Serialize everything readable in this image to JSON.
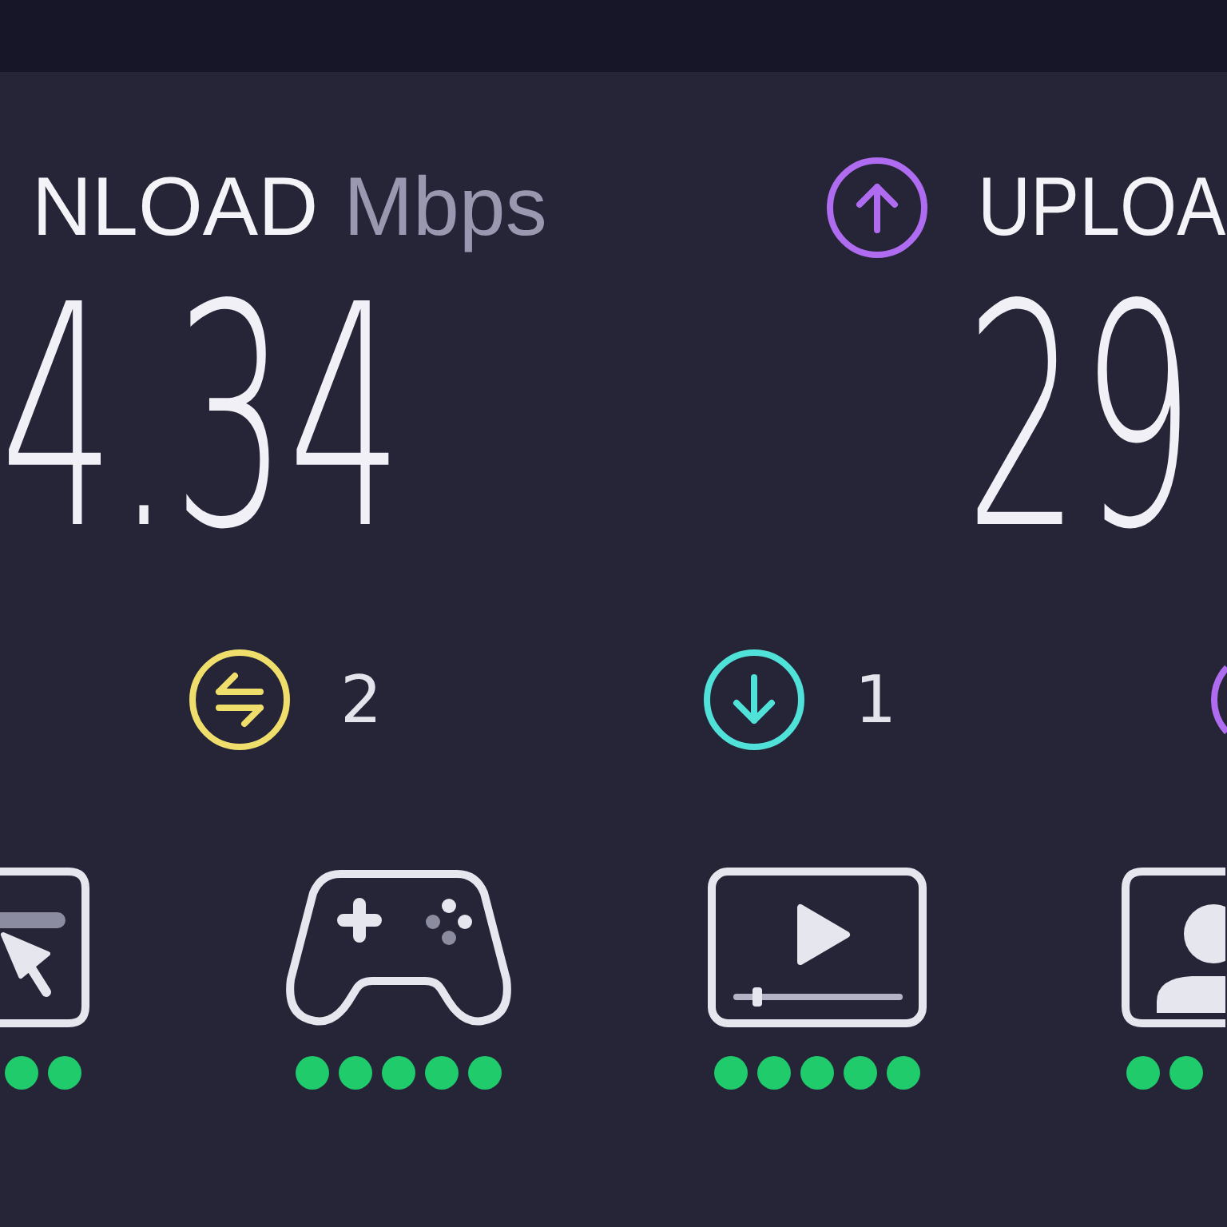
{
  "results": [
    {
      "label": "NLOAD",
      "unit": "Mbps",
      "value": "4.34"
    },
    {
      "label": "UPLOA",
      "value": "29",
      "color": "#b06cf0"
    }
  ],
  "metrics": [
    {
      "kind": "jitter",
      "color": "#f0de6c",
      "value": "2"
    },
    {
      "kind": "download",
      "color": "#50e2d8",
      "value": "1"
    },
    {
      "color": "#b06cf0"
    }
  ],
  "apps": [
    {
      "kind": "browsing"
    },
    {
      "kind": "gaming",
      "stars": 5
    },
    {
      "kind": "streaming",
      "stars": 5
    },
    {
      "kind": "video_call"
    }
  ]
}
